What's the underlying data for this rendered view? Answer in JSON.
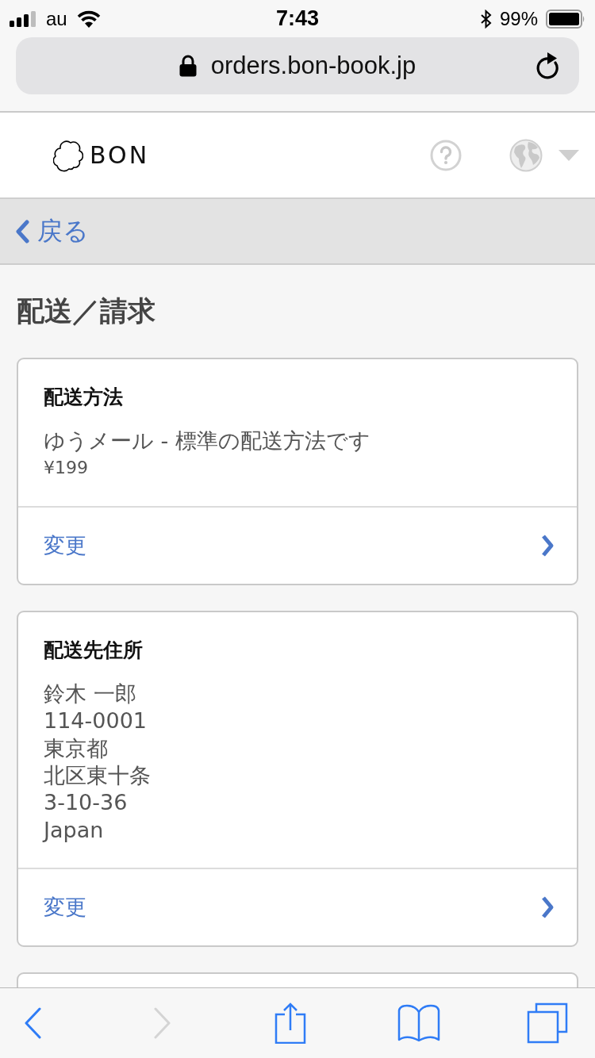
{
  "status_bar": {
    "carrier": "au",
    "time": "7:43",
    "battery": "99%"
  },
  "address_bar": {
    "url": "orders.bon-book.jp"
  },
  "site_header": {
    "logo_text": "BON"
  },
  "back_link": {
    "label": "戻る"
  },
  "page_title": "配送／請求",
  "cards": [
    {
      "kind": "section",
      "title": "配送方法",
      "lines": [
        {
          "kind": "text",
          "text": "ゆうメール - 標準の配送方法です"
        },
        {
          "kind": "price",
          "text": "¥199"
        }
      ],
      "action": "変更"
    },
    {
      "kind": "section",
      "title": "配送先住所",
      "lines": [
        {
          "kind": "text",
          "text": "鈴木 一郎"
        },
        {
          "kind": "text",
          "text": "114-0001"
        },
        {
          "kind": "text",
          "text": "東京都"
        },
        {
          "kind": "text",
          "text": "北区東十条"
        },
        {
          "kind": "text",
          "text": "3-10-36"
        },
        {
          "kind": "text",
          "text": "Japan"
        }
      ],
      "action": "変更"
    },
    {
      "kind": "partial"
    }
  ],
  "toolbar": {
    "buttons": [
      {
        "kind": "back",
        "disabled": false
      },
      {
        "kind": "forward",
        "disabled": true
      },
      {
        "kind": "share",
        "disabled": false
      },
      {
        "kind": "bookmarks",
        "disabled": false
      },
      {
        "kind": "tabs",
        "disabled": false
      }
    ]
  }
}
